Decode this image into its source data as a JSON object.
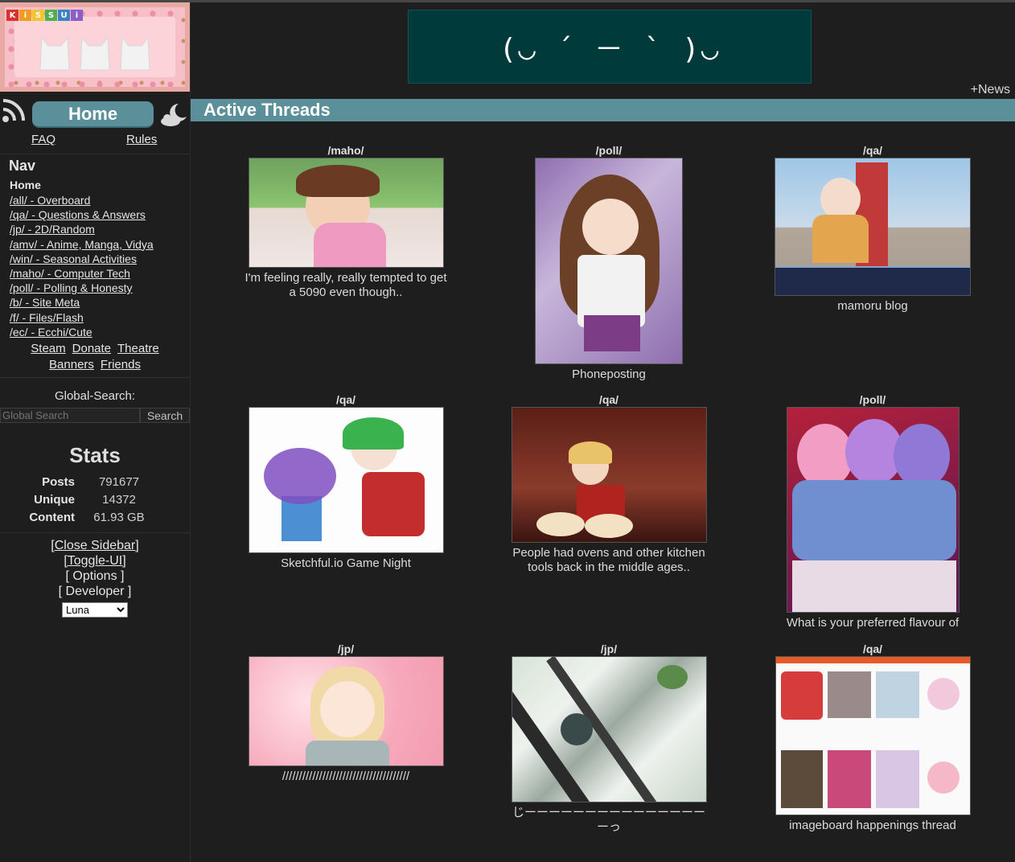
{
  "logo": {
    "letters": [
      "K",
      "i",
      "S",
      "S",
      "U",
      "i"
    ],
    "letter_colors": [
      "#d9322e",
      "#f29c1f",
      "#f4c430",
      "#4fae4f",
      "#3b82c4",
      "#8b5fc7"
    ]
  },
  "sidebar": {
    "home_label": "Home",
    "faq_label": "FAQ",
    "rules_label": "Rules",
    "nav_title": "Nav",
    "nav_home": "Home",
    "nav_items": [
      "/all/ - Overboard",
      "/qa/ - Questions & Answers",
      "/jp/ - 2D/Random",
      "/amv/ - Anime, Manga, Vidya",
      "/win/ - Seasonal Activities",
      "/maho/ - Computer Tech",
      "/poll/ - Polling & Honesty",
      "/b/ - Site Meta",
      "/f/ - Files/Flash",
      "/ec/ - Ecchi/Cute"
    ],
    "extra_links_row1": [
      "Steam",
      "Donate",
      "Theatre"
    ],
    "extra_links_row2": [
      "Banners",
      "Friends"
    ],
    "global_search_label": "Global-Search:",
    "global_search_placeholder": "Global Search",
    "search_button": "Search",
    "stats_title": "Stats",
    "stats": [
      {
        "key": "Posts",
        "value": "791677"
      },
      {
        "key": "Unique",
        "value": "14372"
      },
      {
        "key": "Content",
        "value": "61.93 GB"
      }
    ],
    "close_sidebar": "[Close Sidebar]",
    "toggle_ui": "[Toggle-UI]",
    "options": "[ Options ]",
    "developer": "[ Developer ]",
    "theme_selected": "Luna"
  },
  "header": {
    "banner_text": "(◡ ´ － ` )◡",
    "news_link": "+News",
    "section_title": "Active Threads"
  },
  "threads": [
    {
      "board": "/maho/",
      "subject": "I'm feeling really, really tempted to get a 5090 even though.."
    },
    {
      "board": "/poll/",
      "subject": "Phoneposting"
    },
    {
      "board": "/qa/",
      "subject": "mamoru blog"
    },
    {
      "board": "/qa/",
      "subject": "Sketchful.io Game Night"
    },
    {
      "board": "/qa/",
      "subject": "People had ovens and other kitchen tools back in the middle ages.."
    },
    {
      "board": "/poll/",
      "subject": "What is your preferred flavour of"
    },
    {
      "board": "/jp/",
      "subject": "//////////////////////////////////////"
    },
    {
      "board": "/jp/",
      "subject": "じーーーーーーーーーーーーーーーーっ"
    },
    {
      "board": "/qa/",
      "subject": "imageboard happenings thread"
    }
  ],
  "colors": {
    "accent": "#5b8f99",
    "background": "#1e1e1e",
    "banner_bg": "#003a3a"
  }
}
